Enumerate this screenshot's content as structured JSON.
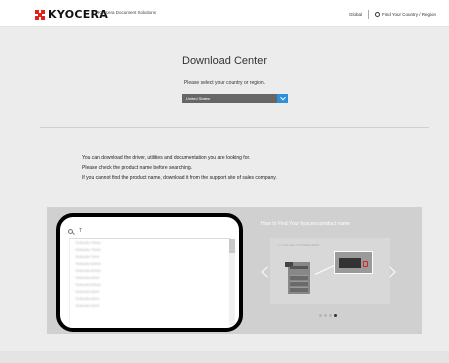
{
  "header": {
    "logo_text": "KYOCERA",
    "logo_subtitle": "Kyocera Document Solutions",
    "global_link": "Global",
    "region_link": "Find Your Country / Region"
  },
  "main": {
    "title": "Download Center",
    "select_prompt": "Please select your country or region.",
    "country_select": {
      "value": "United States"
    },
    "info_lines": [
      "You can download the driver, utilities and documentation you are looking for.",
      "Please check the product name before searching.",
      "If you cannot find the product name, download it from the support site of sales company."
    ]
  },
  "search": {
    "value": "T",
    "results": [
      "TASKalfa 7054ci",
      "TASKalfa 7004ci",
      "TASKalfa 7004i",
      "TASKalfa 6054ci",
      "TASKalfa 6004ci",
      "TASKalfa 6004i",
      "TASKalfa 5054ci",
      "TASKalfa 5004i",
      "TASKalfa 5004i",
      "TASKalfa 5004i"
    ]
  },
  "carousel": {
    "heading": "How to Find Your kyocera product name",
    "step_text": "1. In the case of TASKalfa 4054ci",
    "slides_total": 4,
    "active_slide": 4
  },
  "colors": {
    "brand_red": "#e0211b",
    "select_button_blue": "#2f8fd9",
    "panel_gray": "#d0d0d0"
  }
}
